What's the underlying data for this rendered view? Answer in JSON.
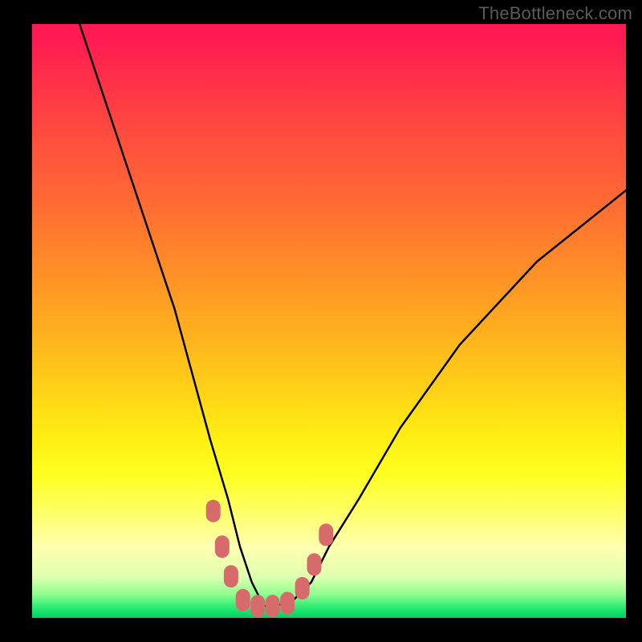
{
  "watermark": {
    "text": "TheBottleneck.com"
  },
  "chart_data": {
    "type": "line",
    "title": "",
    "xlabel": "",
    "ylabel": "",
    "xlim": [
      0,
      100
    ],
    "ylim": [
      0,
      100
    ],
    "grid": false,
    "legend": false,
    "background_gradient": {
      "direction": "vertical",
      "stops": [
        {
          "pos": 0.0,
          "color": "#ff1a53"
        },
        {
          "pos": 0.3,
          "color": "#ff6a33"
        },
        {
          "pos": 0.62,
          "color": "#ffd317"
        },
        {
          "pos": 0.82,
          "color": "#ffff66"
        },
        {
          "pos": 0.93,
          "color": "#e0ffb0"
        },
        {
          "pos": 1.0,
          "color": "#00d060"
        }
      ]
    },
    "series": [
      {
        "name": "bottleneck-curve",
        "color": "#000000",
        "x": [
          8,
          12,
          16,
          20,
          24,
          27,
          30,
          33,
          35,
          37,
          39,
          41,
          44,
          47,
          50,
          55,
          62,
          72,
          85,
          100
        ],
        "y": [
          100,
          88,
          76,
          64,
          52,
          41,
          30,
          20,
          12,
          6,
          2,
          2,
          3,
          6,
          12,
          20,
          32,
          46,
          60,
          72
        ]
      }
    ],
    "markers": {
      "name": "highlight-points",
      "color": "#d76b6b",
      "shape": "rounded-rect",
      "points": [
        {
          "x": 30.5,
          "y": 18
        },
        {
          "x": 32.0,
          "y": 12
        },
        {
          "x": 33.5,
          "y": 7
        },
        {
          "x": 35.5,
          "y": 3
        },
        {
          "x": 38.0,
          "y": 2
        },
        {
          "x": 40.5,
          "y": 2
        },
        {
          "x": 43.0,
          "y": 2.5
        },
        {
          "x": 45.5,
          "y": 5
        },
        {
          "x": 47.5,
          "y": 9
        },
        {
          "x": 49.5,
          "y": 14
        }
      ]
    }
  }
}
